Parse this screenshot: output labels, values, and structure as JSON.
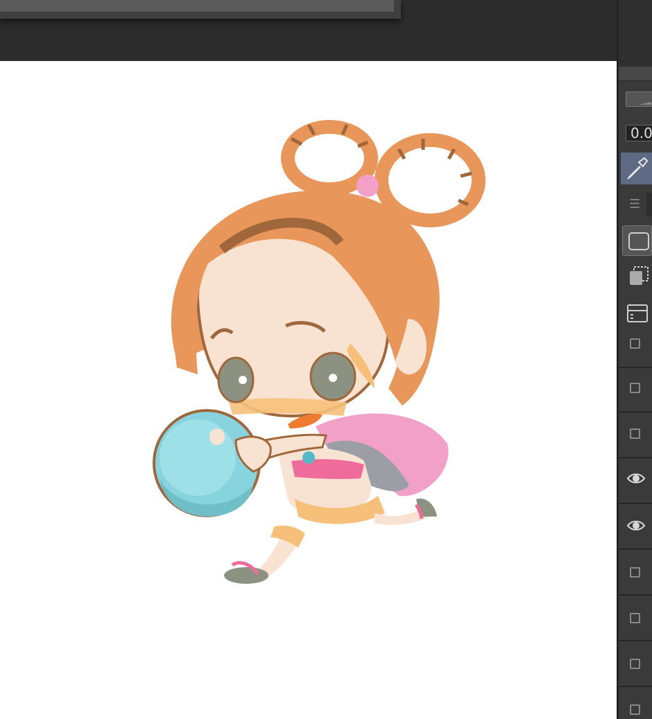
{
  "app": {
    "canvas_background": "#ffffff",
    "accent": "#5e6a84"
  },
  "sidebar": {
    "opacity_value": "0.0",
    "menu_icon": "hamburger-icon",
    "tools": [
      {
        "icon": "rectangle-icon",
        "active": true
      },
      {
        "icon": "selection-copy-icon",
        "active": false
      },
      {
        "icon": "layer-property-icon",
        "active": false
      }
    ],
    "layers": [
      {
        "visible": false
      },
      {
        "visible": false
      },
      {
        "visible": false
      },
      {
        "visible": true
      },
      {
        "visible": true
      },
      {
        "visible": false
      },
      {
        "visible": false
      },
      {
        "visible": false
      },
      {
        "visible": false
      }
    ]
  }
}
